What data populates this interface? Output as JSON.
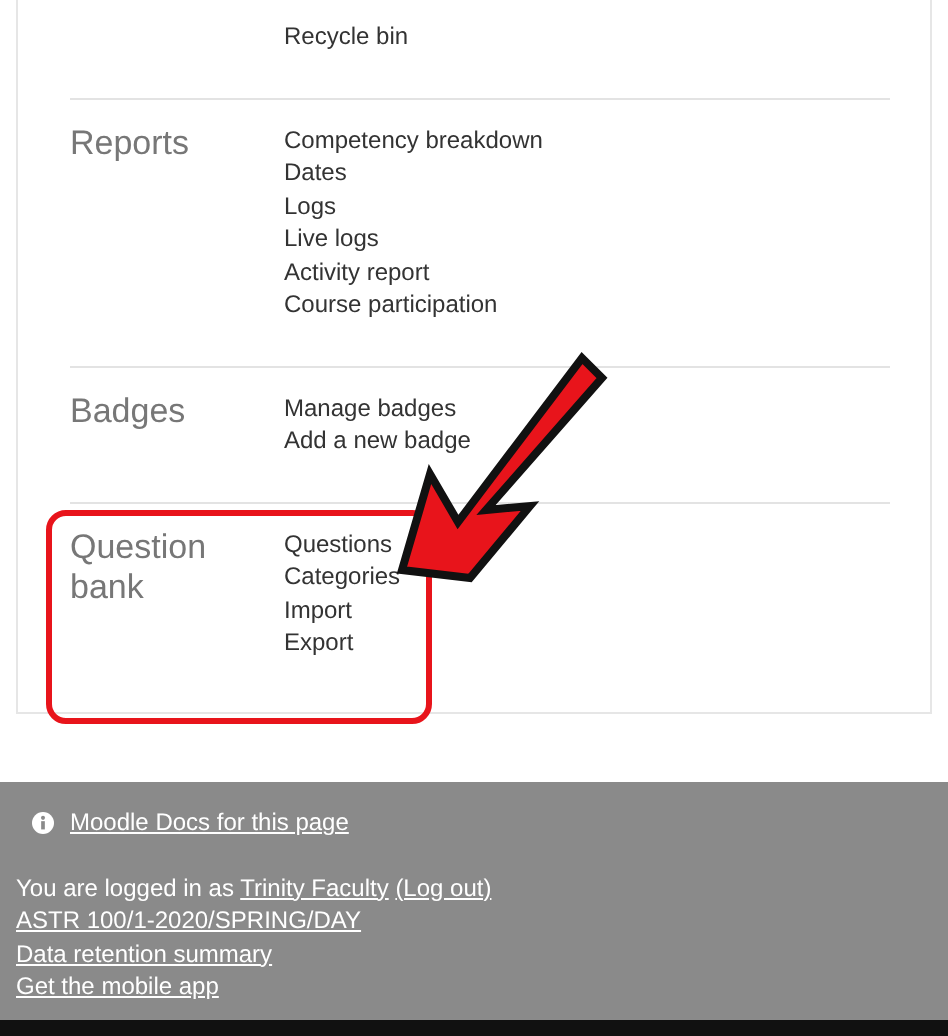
{
  "sections": [
    {
      "links": [
        "Recycle bin"
      ]
    },
    {
      "title": "Reports",
      "links": [
        "Competency breakdown",
        "Dates",
        "Logs",
        "Live logs",
        "Activity report",
        "Course participation"
      ],
      "highlighted": false
    },
    {
      "title": "Badges",
      "links": [
        "Manage badges",
        "Add a new badge"
      ],
      "highlighted": false
    },
    {
      "title": "Question bank",
      "links": [
        "Questions",
        "Categories",
        "Import",
        "Export"
      ],
      "highlighted": true
    }
  ],
  "footer": {
    "docs_link": "Moodle Docs for this page",
    "logged_in_prefix": "You are logged in as",
    "user": "Trinity Faculty",
    "logout": "(Log out)",
    "links": [
      "ASTR 100/1-2020/SPRING/DAY",
      "Data retention summary",
      "Get the mobile app"
    ]
  }
}
